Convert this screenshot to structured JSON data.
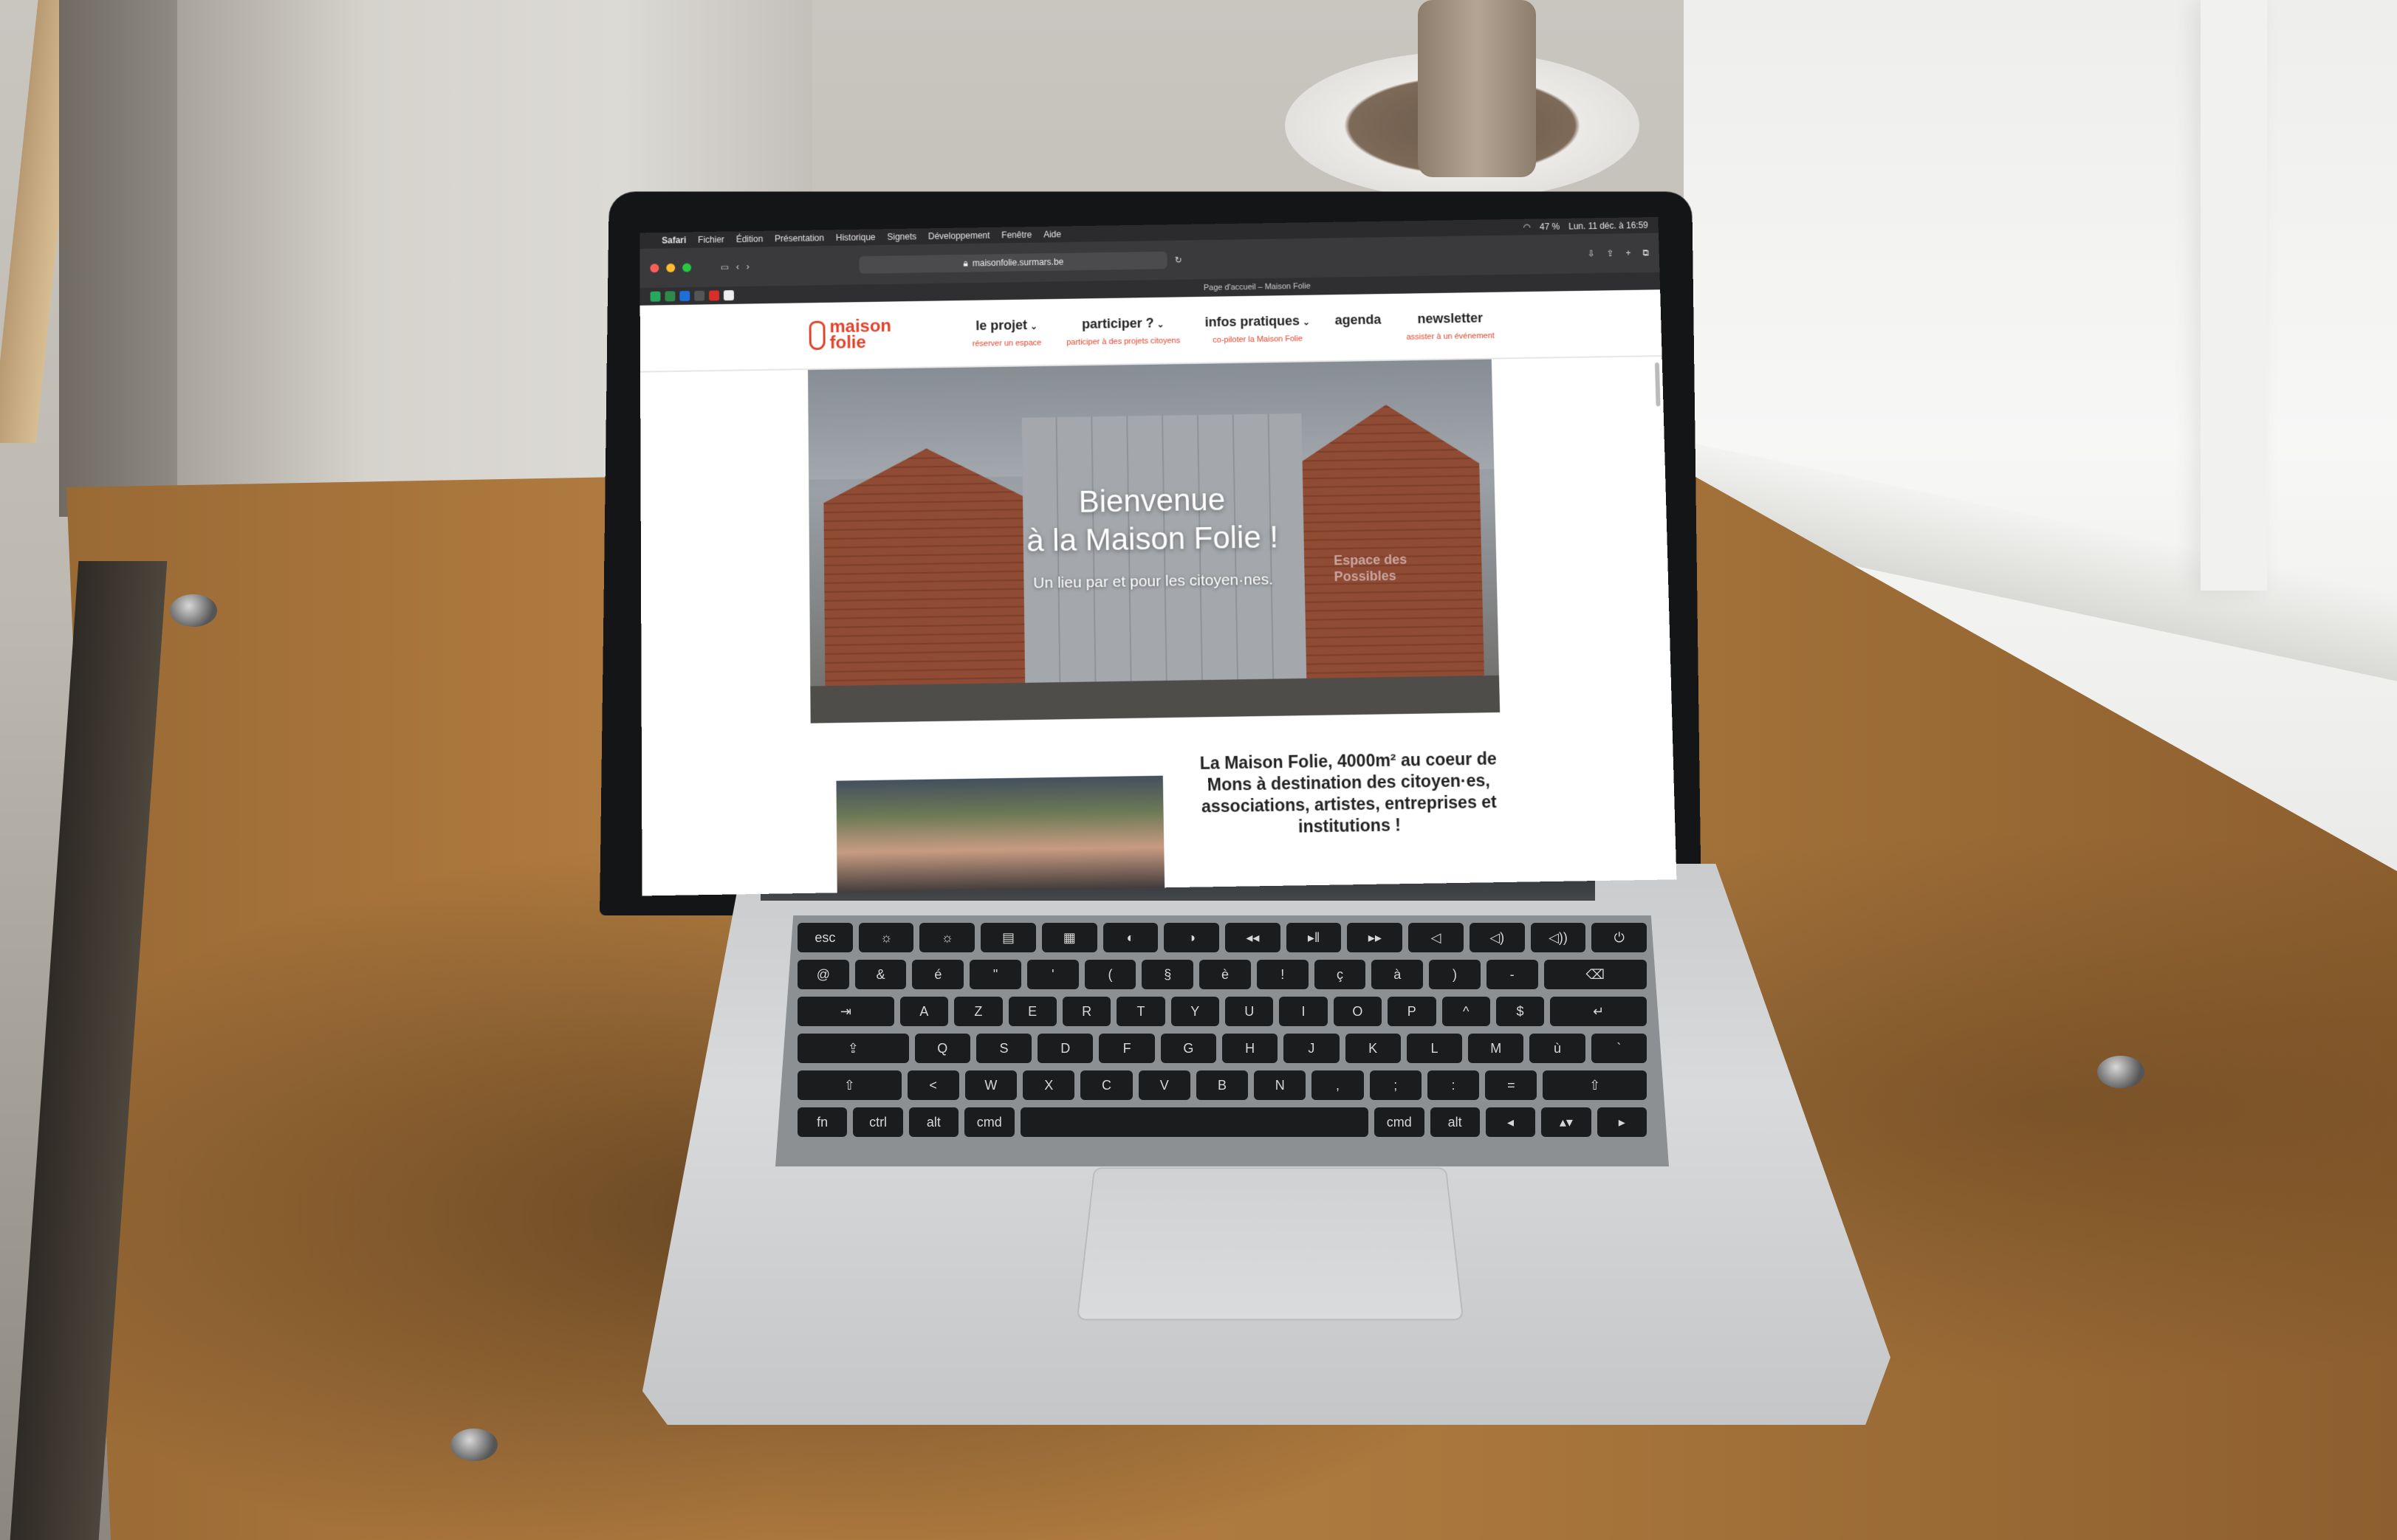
{
  "browser": {
    "app_menu": [
      "Safari",
      "Fichier",
      "Édition",
      "Présentation",
      "Historique",
      "Signets",
      "Développement",
      "Fenêtre",
      "Aide"
    ],
    "clock": "Lun. 11 déc. à 16:59",
    "battery": "47 %",
    "url": "maisonfolie.surmars.be",
    "tab_title": "Page d'accueil – Maison Folie"
  },
  "site": {
    "logo_text_1": "maison",
    "logo_text_2": "folie",
    "nav": [
      {
        "label": "le projet",
        "sub": "réserver un espace"
      },
      {
        "label": "participer ?",
        "sub": "participer à des projets citoyens"
      },
      {
        "label": "infos pratiques",
        "sub": "co-piloter la Maison Folie"
      },
      {
        "label": "agenda",
        "sub": ""
      },
      {
        "label": "newsletter",
        "sub": "assister à un événement"
      }
    ],
    "hero": {
      "title_line1": "Bienvenue",
      "title_line2": "à la Maison Folie !",
      "subtitle": "Un lieu par et pour les citoyen·nes.",
      "sign_line1": "Espace des",
      "sign_line2": "Possibles"
    },
    "intro": {
      "text": "La Maison Folie, 4000m² au coeur de Mons à destination des citoyen·es, associations, artistes, entreprises et institutions !"
    }
  },
  "keyboard": {
    "rows": [
      [
        "esc",
        "☼",
        "☼",
        "▤",
        "▦",
        "◐",
        "◑",
        "◂◂",
        "▸‖",
        "▸▸",
        "◁",
        "◁)",
        "◁))",
        "⏻"
      ],
      [
        "@",
        "&",
        "é",
        "\"",
        "'",
        "(",
        "§",
        "è",
        "!",
        "ç",
        "à",
        ")",
        "-",
        "⌫"
      ],
      [
        "⇥",
        "A",
        "Z",
        "E",
        "R",
        "T",
        "Y",
        "U",
        "I",
        "O",
        "P",
        "^",
        "$",
        "↵"
      ],
      [
        "⇪",
        "Q",
        "S",
        "D",
        "F",
        "G",
        "H",
        "J",
        "K",
        "L",
        "M",
        "ù",
        "`"
      ],
      [
        "⇧",
        "<",
        "W",
        "X",
        "C",
        "V",
        "B",
        "N",
        ",",
        ";",
        ":",
        "=",
        "⇧"
      ],
      [
        "fn",
        "ctrl",
        "alt",
        "cmd",
        " ",
        "cmd",
        "alt",
        "◂",
        "▴▾",
        "▸"
      ]
    ]
  }
}
